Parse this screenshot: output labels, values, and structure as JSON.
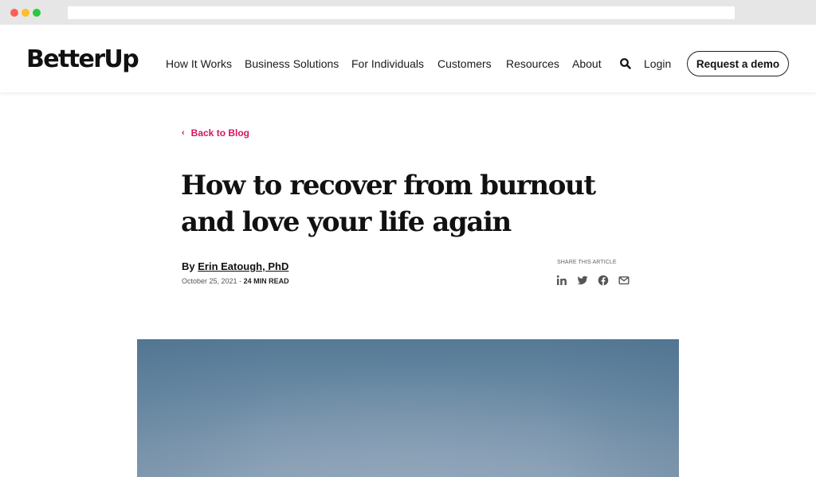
{
  "browser": {
    "address": ""
  },
  "header": {
    "logo": "BetterUp",
    "nav": [
      {
        "label": "How It Works"
      },
      {
        "label": "Business Solutions"
      },
      {
        "label": "For Individuals"
      },
      {
        "label": "Customers"
      },
      {
        "label": "Resources"
      },
      {
        "label": "About"
      }
    ],
    "search_icon": "search-icon",
    "login_label": "Login",
    "cta_label": "Request a demo"
  },
  "article": {
    "back_label": "Back to Blog",
    "back_icon": "chevron-left-icon",
    "title": "How to recover from burnout and love your life again",
    "byline_prefix": "By",
    "author": "Erin Eatough, PhD",
    "date": "October 25, 2021",
    "separator": " - ",
    "read_time": "24 MIN READ",
    "share_label": "SHARE THIS ARTICLE",
    "share_icons": [
      "linkedin-icon",
      "twitter-icon",
      "facebook-icon",
      "email-icon"
    ]
  },
  "colors": {
    "accent": "#d6145f",
    "text": "#111111",
    "hero_sky": "#6a8aa4"
  }
}
